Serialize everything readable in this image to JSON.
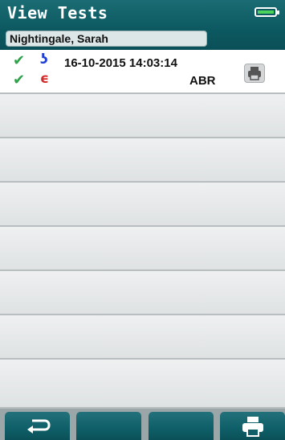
{
  "header": {
    "title": "View Tests",
    "patient_name": "Nightingale, Sarah",
    "battery_icon": "battery-charging-icon",
    "colors": {
      "header_bg": "#0d5a62",
      "battery_fill": "#49d35a"
    }
  },
  "tests": [
    {
      "date_time": "16-10-2015  14:03:14",
      "protocol": "ABR",
      "right_ear": {
        "icon": "right-ear-icon",
        "result": "pass",
        "color": "#1f3fd9"
      },
      "left_ear": {
        "icon": "left-ear-icon",
        "result": "pass",
        "color": "#d12a2a"
      },
      "print_icon": "printer-icon"
    }
  ],
  "empty_rows": 7,
  "footer": {
    "buttons": [
      {
        "icon": "back-arrow-icon"
      },
      {
        "icon": ""
      },
      {
        "icon": ""
      },
      {
        "icon": "printer-icon"
      }
    ]
  }
}
